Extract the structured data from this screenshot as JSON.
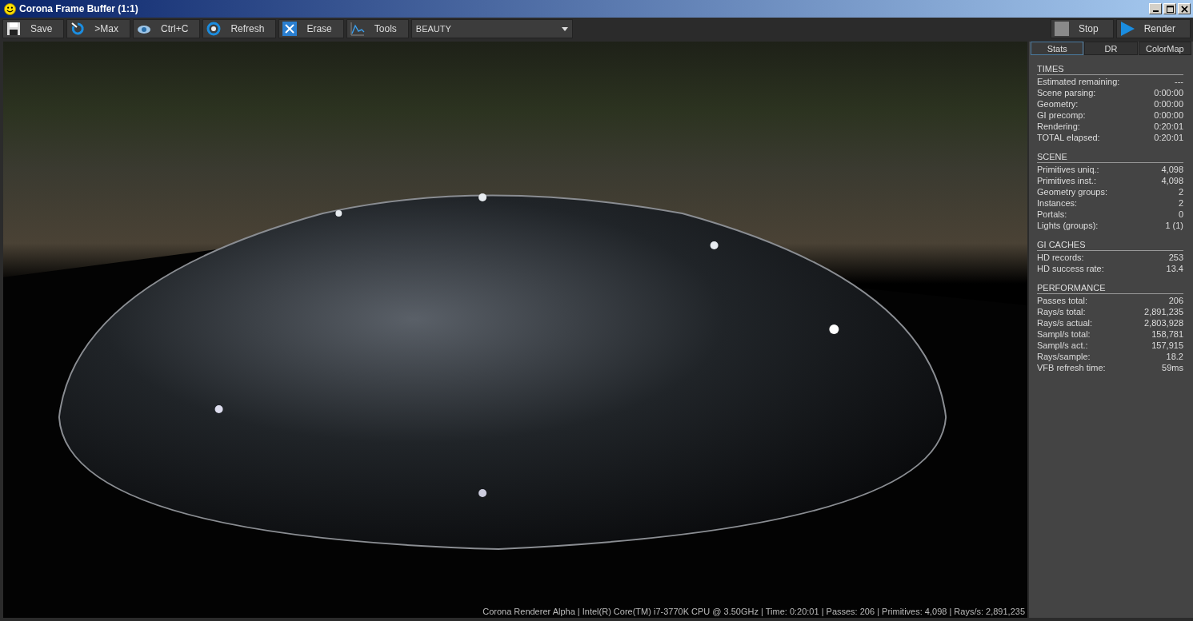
{
  "window": {
    "title": "Corona Frame Buffer (1:1)"
  },
  "toolbar": {
    "buttons": [
      {
        "label": "Save"
      },
      {
        "label": ">Max"
      },
      {
        "label": "Ctrl+C"
      },
      {
        "label": "Refresh"
      },
      {
        "label": "Erase"
      },
      {
        "label": "Tools"
      }
    ],
    "channel": {
      "value": "BEAUTY"
    },
    "right_buttons": [
      {
        "label": "Stop"
      },
      {
        "label": "Render"
      }
    ]
  },
  "viewport": {
    "status": "Corona Renderer Alpha | Intel(R) Core(TM) i7-3770K CPU @ 3.50GHz | Time: 0:20:01 | Passes: 206 | Primitives: 4,098 | Rays/s: 2,891,235"
  },
  "tabs": [
    {
      "label": "Stats",
      "selected": true
    },
    {
      "label": "DR",
      "selected": false
    },
    {
      "label": "ColorMap",
      "selected": false
    }
  ],
  "sections": [
    {
      "title": "TIMES",
      "rows": [
        {
          "label": "Estimated remaining:",
          "value": "---"
        },
        {
          "label": "Scene parsing:",
          "value": "0:00:00"
        },
        {
          "label": "Geometry:",
          "value": "0:00:00"
        },
        {
          "label": "GI precomp:",
          "value": "0:00:00"
        },
        {
          "label": "Rendering:",
          "value": "0:20:01"
        },
        {
          "label": "TOTAL elapsed:",
          "value": "0:20:01"
        }
      ]
    },
    {
      "title": "SCENE",
      "rows": [
        {
          "label": "Primitives uniq.:",
          "value": "4,098"
        },
        {
          "label": "Primitives inst.:",
          "value": "4,098"
        },
        {
          "label": "Geometry groups:",
          "value": "2"
        },
        {
          "label": "Instances:",
          "value": "2"
        },
        {
          "label": "Portals:",
          "value": "0"
        },
        {
          "label": "Lights (groups):",
          "value": "1 (1)"
        }
      ]
    },
    {
      "title": "GI CACHES",
      "rows": [
        {
          "label": "HD records:",
          "value": "253"
        },
        {
          "label": "HD success rate:",
          "value": "13.4"
        }
      ]
    },
    {
      "title": "PERFORMANCE",
      "rows": [
        {
          "label": "Passes total:",
          "value": "206"
        },
        {
          "label": "Rays/s total:",
          "value": "2,891,235"
        },
        {
          "label": "Rays/s actual:",
          "value": "2,803,928"
        },
        {
          "label": "Sampl/s total:",
          "value": "158,781"
        },
        {
          "label": "Sampl/s act.:",
          "value": "157,915"
        },
        {
          "label": "Rays/sample:",
          "value": "18.2"
        },
        {
          "label": "VFB refresh time:",
          "value": "59ms"
        }
      ]
    }
  ]
}
